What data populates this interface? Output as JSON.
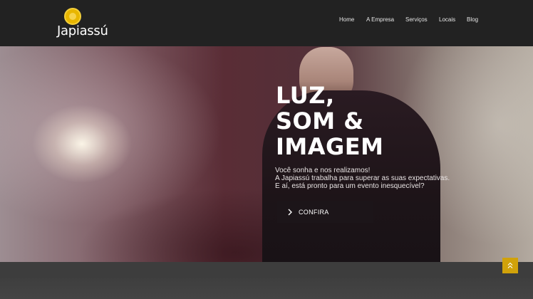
{
  "brand": {
    "logo_text": "Japiassú",
    "accent": "#e8b600"
  },
  "nav": {
    "items": [
      {
        "label": "Home"
      },
      {
        "label": "A Empresa"
      },
      {
        "label": "Serviços"
      },
      {
        "label": "Locais"
      },
      {
        "label": "Blog"
      }
    ]
  },
  "hero": {
    "title_lines": [
      "LUZ,",
      "SOM &",
      "IMAGEM"
    ],
    "text_lines": [
      "Você sonha e nos realizamos!",
      "A Japiassú trabalha para superar as suas expectativas.",
      "E aí, está pronto para um evento inesquecível?"
    ],
    "cta_label": "CONFIRA",
    "cta_icon": "chevron-right-icon"
  },
  "scroll_top": {
    "icon": "double-chevron-up-icon"
  }
}
